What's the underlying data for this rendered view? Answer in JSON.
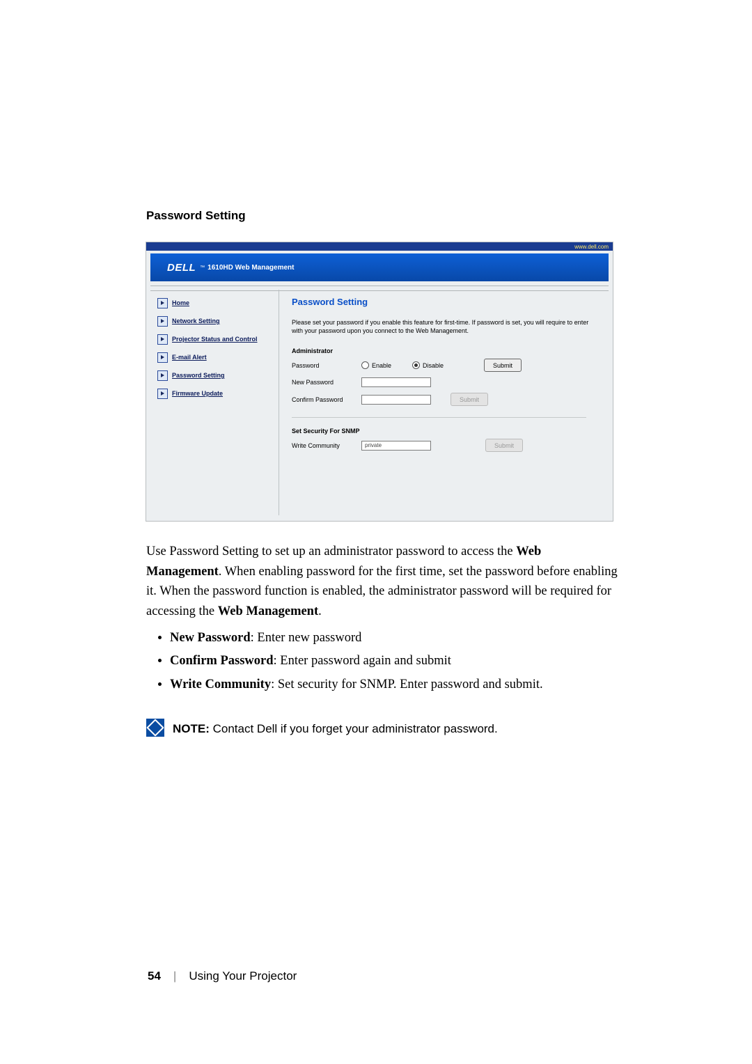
{
  "heading": "Password Setting",
  "shot": {
    "url": "www.dell.com",
    "logo": "DELL",
    "tm": "™",
    "banner_title": "1610HD Web Management",
    "sidebar": [
      {
        "label": "Home"
      },
      {
        "label": "Network Setting"
      },
      {
        "label": "Projector Status and Control"
      },
      {
        "label": "E-mail Alert"
      },
      {
        "label": "Password Setting"
      },
      {
        "label": "Firmware Update"
      }
    ],
    "panel": {
      "title": "Password Setting",
      "desc": "Please set your password if you enable this feature for first-time. If password is set, you will require to enter with your password upon you connect to the Web Management.",
      "admin_heading": "Administrator",
      "pw_label": "Password",
      "enable": "Enable",
      "disable": "Disable",
      "submit": "Submit",
      "newpw_label": "New Password",
      "confpw_label": "Confirm Password",
      "snmp_heading": "Set Security For SNMP",
      "writecom_label": "Write Community",
      "writecom_value": "private"
    }
  },
  "body": {
    "p1a": "Use Password Setting to set up an administrator password to access the ",
    "p1b": "Web Management",
    "p1c": ". When enabling password for the first time, set the password before enabling it. When the password function is enabled, the administrator password will be required for accessing the ",
    "p1d": "Web Management",
    "p1e": ".",
    "bullets": [
      {
        "b": "New Password",
        "rest": ": Enter new password"
      },
      {
        "b": "Confirm Password",
        "rest": ": Enter password again and submit"
      },
      {
        "b": "Write Community",
        "rest": ": Set security for SNMP. Enter password and submit."
      }
    ]
  },
  "note": {
    "b": "NOTE:",
    "text": " Contact Dell if you forget your administrator password."
  },
  "footer": {
    "page": "54",
    "section": "Using Your Projector"
  }
}
